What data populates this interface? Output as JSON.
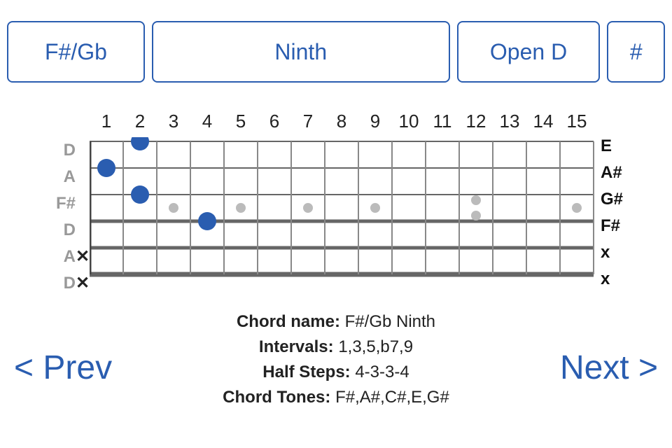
{
  "selectors": {
    "root": "F#/Gb",
    "type": "Ninth",
    "tuning": "Open D",
    "sharp": "#"
  },
  "fretboard": {
    "fret_labels": [
      "1",
      "2",
      "3",
      "4",
      "5",
      "6",
      "7",
      "8",
      "9",
      "10",
      "11",
      "12",
      "13",
      "14",
      "15"
    ],
    "tuning_labels": [
      "D",
      "A",
      "F#",
      "D",
      "A",
      "D"
    ],
    "played_notes": [
      "E",
      "A#",
      "G#",
      "F#",
      "x",
      "x"
    ],
    "mutes": [
      "",
      "",
      "",
      "",
      "✕",
      "✕"
    ],
    "inlay_frets": [
      3,
      5,
      7,
      9,
      12,
      15
    ],
    "inlay_double_fret": 12,
    "dots": [
      {
        "string": 0,
        "fret": 2
      },
      {
        "string": 1,
        "fret": 1
      },
      {
        "string": 2,
        "fret": 2
      },
      {
        "string": 3,
        "fret": 4
      }
    ]
  },
  "info": {
    "chord_name_label": "Chord name:",
    "chord_name": "F#/Gb Ninth",
    "intervals_label": "Intervals:",
    "intervals": "1,3,5,b7,9",
    "half_steps_label": "Half Steps:",
    "half_steps": "4-3-3-4",
    "chord_tones_label": "Chord Tones:",
    "chord_tones": "F#,A#,C#,E,G#"
  },
  "nav": {
    "prev": "< Prev",
    "next": "Next >"
  }
}
